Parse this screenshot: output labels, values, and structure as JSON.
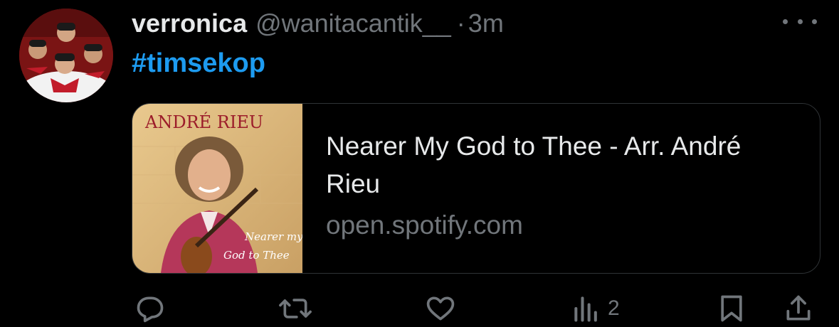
{
  "tweet": {
    "display_name": "verronica",
    "handle": "@wanitacantik__",
    "separator": "·",
    "time": "3m",
    "hashtag": "#timsekop"
  },
  "card": {
    "image_album_artist": "ANDRÉ RIEU",
    "image_album_title_line1": "Nearer my",
    "image_album_title_line2": "God to Thee",
    "title": "Nearer My God to Thee - Arr. André Rieu",
    "domain": "open.spotify.com"
  },
  "actions": {
    "reply_icon": "reply-icon",
    "retweet_icon": "retweet-icon",
    "like_icon": "heart-icon",
    "views_icon": "views-icon",
    "views_count": "2",
    "bookmark_icon": "bookmark-icon",
    "share_icon": "share-icon"
  },
  "colors": {
    "background": "#000000",
    "text": "#e7e9ea",
    "secondary": "#71767b",
    "link": "#1d9bf0",
    "border": "#2f3336"
  }
}
